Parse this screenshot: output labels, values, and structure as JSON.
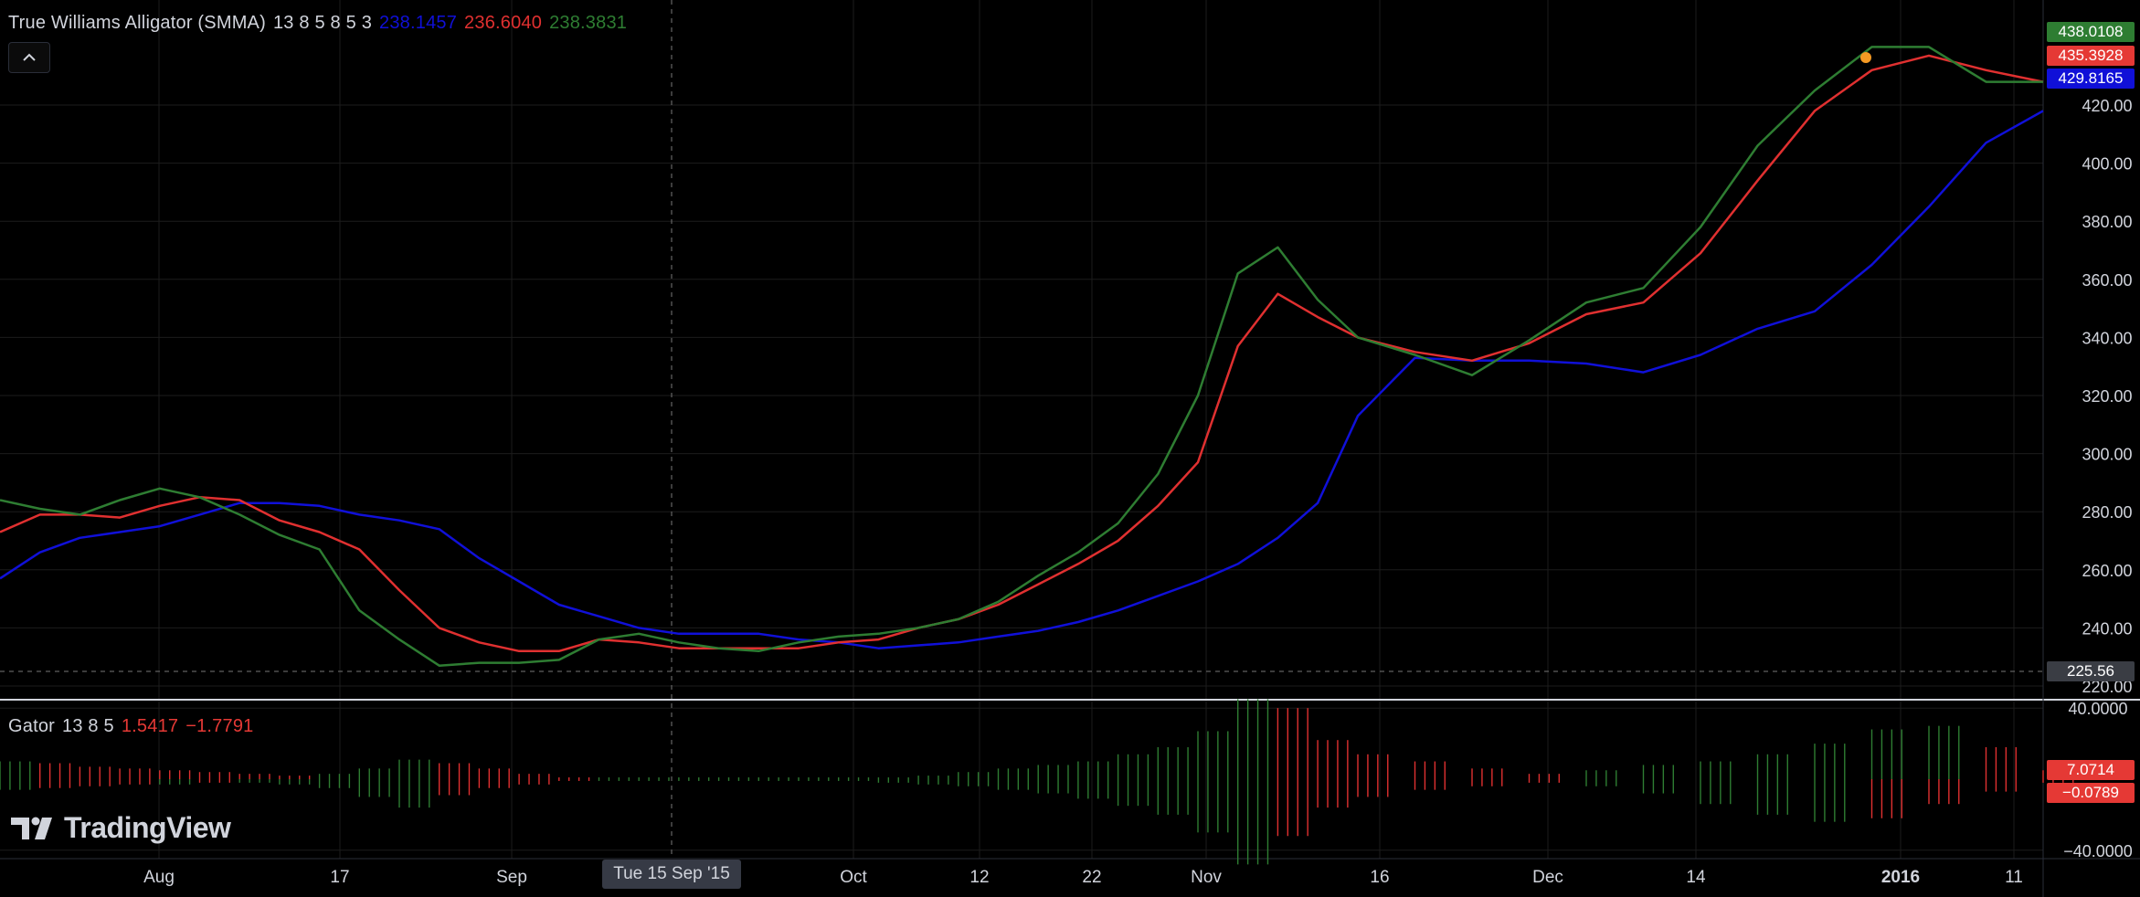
{
  "main_legend": {
    "name": "True Williams Alligator (SMMA)",
    "params": "13 8 5 8 5 3",
    "jaw_value": "238.1457",
    "teeth_value": "236.6040",
    "lips_value": "238.3831"
  },
  "gator_legend": {
    "name": "Gator",
    "params": "13 8 5",
    "upper_value": "1.5417",
    "lower_value": "−1.7791"
  },
  "price_tags": {
    "lips": "438.0108",
    "teeth": "435.3928",
    "jaw": "429.8165",
    "crosshair": "225.56",
    "gator_upper": "7.0714",
    "gator_lower": "−0.0789"
  },
  "crosshair_date": "Tue 15 Sep '15",
  "logo_text": "TradingView",
  "colors": {
    "jaw": "#1010d8",
    "teeth": "#e03030",
    "lips": "#2e7d32",
    "background": "#000000",
    "grid": "#1c1c1c",
    "text": "#d1d4dc",
    "tag_green": "#2e7d32",
    "tag_red": "#e53935",
    "tag_blue": "#1010d8",
    "tag_gray": "#3a3d44"
  },
  "icons": {
    "collapse": "chevron-up-icon",
    "logo": "tradingview-logo-icon"
  },
  "chart_data": [
    {
      "type": "line",
      "title": "True Williams Alligator (SMMA)",
      "x_ticks": [
        "Aug",
        "17",
        "Sep",
        "Oct",
        "12",
        "22",
        "Nov",
        "16",
        "Dec",
        "14",
        "2016",
        "11"
      ],
      "y_ticks": [
        220,
        240,
        260,
        280,
        300,
        320,
        340,
        360,
        380,
        400,
        420
      ],
      "ylim": [
        218,
        441
      ],
      "grid": true,
      "series": [
        {
          "name": "jaw",
          "color": "#1010d8",
          "x": [
            0,
            0.5,
            1,
            1.5,
            2,
            2.5,
            3,
            3.5,
            4,
            4.5,
            5,
            5.5,
            6,
            6.5,
            7,
            7.5,
            8,
            8.5,
            9,
            9.5,
            10,
            10.5,
            11,
            11.5,
            12,
            12.5,
            13,
            13.5,
            14,
            14.5,
            15,
            15.5,
            16,
            16.5,
            17,
            17.5,
            18,
            18.5,
            19,
            19.5,
            20,
            20.5,
            21,
            21.5,
            22,
            22.5,
            23
          ],
          "y": [
            257,
            266,
            271,
            273,
            275,
            279,
            283,
            283,
            282,
            279,
            277,
            274,
            264,
            256,
            248,
            244,
            240,
            238,
            238,
            238,
            236,
            235,
            233,
            234,
            235,
            237,
            239,
            242,
            246,
            251,
            256,
            262,
            271,
            283,
            313,
            333,
            332,
            332,
            331,
            328,
            334,
            343,
            349,
            365,
            385,
            407,
            418
          ]
        },
        {
          "name": "teeth",
          "color": "#e03030",
          "x": [
            0,
            0.5,
            1,
            1.5,
            2,
            2.5,
            3,
            3.5,
            4,
            4.5,
            5,
            5.5,
            6,
            6.5,
            7,
            7.5,
            8,
            8.5,
            9,
            9.5,
            10,
            10.5,
            11,
            11.5,
            12,
            12.5,
            13,
            13.5,
            14,
            14.5,
            15,
            15.5,
            16,
            16.5,
            17,
            17.5,
            18,
            18.5,
            19,
            19.5,
            20,
            20.5,
            21,
            21.5,
            22,
            22.5,
            23
          ],
          "y": [
            273,
            279,
            279,
            278,
            282,
            285,
            284,
            277,
            273,
            267,
            253,
            240,
            235,
            232,
            232,
            236,
            235,
            233,
            233,
            233,
            233,
            235,
            236,
            240,
            243,
            248,
            255,
            262,
            270,
            282,
            297,
            337,
            355,
            347,
            340,
            335,
            332,
            338,
            348,
            352,
            369,
            394,
            418,
            432,
            437,
            432,
            428
          ]
        },
        {
          "name": "lips",
          "color": "#2e7d32",
          "x": [
            0,
            0.5,
            1,
            1.5,
            2,
            2.5,
            3,
            3.5,
            4,
            4.5,
            5,
            5.5,
            6,
            6.5,
            7,
            7.5,
            8,
            8.5,
            9,
            9.5,
            10,
            10.5,
            11,
            11.5,
            12,
            12.5,
            13,
            13.5,
            14,
            14.5,
            15,
            15.5,
            16,
            16.5,
            17,
            17.5,
            18,
            18.5,
            19,
            19.5,
            20,
            20.5,
            21,
            21.5,
            22,
            22.5,
            23
          ],
          "y": [
            284,
            281,
            279,
            284,
            288,
            285,
            279,
            272,
            267,
            246,
            236,
            227,
            228,
            228,
            229,
            236,
            238,
            235,
            233,
            232,
            235,
            237,
            238,
            240,
            243,
            249,
            258,
            266,
            276,
            293,
            320,
            362,
            371,
            353,
            340,
            334,
            327,
            339,
            352,
            357,
            378,
            406,
            425,
            440,
            440,
            428,
            428
          ]
        }
      ]
    },
    {
      "type": "bar",
      "title": "Gator",
      "y_ticks": [
        -40,
        40
      ],
      "ylim": [
        -48,
        48
      ],
      "grid": true,
      "series": [
        {
          "name": "upper",
          "color_up": "#2e7d32",
          "color_down": "#e03030",
          "x": [
            0,
            0.5,
            1,
            1.5,
            2,
            2.5,
            3,
            3.5,
            4,
            4.5,
            5,
            5.5,
            6,
            6.5,
            7,
            7.5,
            8,
            8.5,
            9,
            9.5,
            10,
            10.5,
            11,
            11.5,
            12,
            12.5,
            13,
            13.5,
            14,
            14.5,
            15,
            15.5,
            16,
            16.5,
            17,
            17.5,
            18,
            18.5,
            19,
            19.5,
            20,
            20.5,
            21,
            21.5,
            22,
            22.5,
            23
          ],
          "y": [
            10,
            9,
            7,
            6,
            5,
            4,
            3,
            2,
            3,
            6,
            11,
            9,
            6,
            3,
            1,
            1,
            1,
            1,
            1,
            1,
            1,
            1,
            1,
            2,
            4,
            6,
            8,
            10,
            14,
            18,
            27,
            45,
            40,
            22,
            14,
            10,
            6,
            3,
            5,
            8,
            10,
            14,
            20,
            28,
            30,
            18,
            5
          ]
        },
        {
          "name": "lower",
          "color_up": "#2e7d32",
          "color_down": "#e03030",
          "x": [
            0,
            0.5,
            1,
            1.5,
            2,
            2.5,
            3,
            3.5,
            4,
            4.5,
            5,
            5.5,
            6,
            6.5,
            7,
            7.5,
            8,
            8.5,
            9,
            9.5,
            10,
            10.5,
            11,
            11.5,
            12,
            12.5,
            13,
            13.5,
            14,
            14.5,
            15,
            15.5,
            16,
            16.5,
            17,
            17.5,
            18,
            18.5,
            19,
            19.5,
            20,
            20.5,
            21,
            21.5,
            22,
            22.5,
            23
          ],
          "y": [
            -6,
            -5,
            -4,
            -3,
            -3,
            -2,
            -2,
            -3,
            -5,
            -10,
            -16,
            -9,
            -5,
            -3,
            -1,
            -1,
            -1,
            -1,
            -1,
            -1,
            -1,
            -1,
            -2,
            -3,
            -4,
            -6,
            -8,
            -11,
            -15,
            -20,
            -30,
            -48,
            -32,
            -16,
            -10,
            -6,
            -4,
            -2,
            -4,
            -8,
            -14,
            -20,
            -24,
            -22,
            -14,
            -7,
            -2
          ]
        }
      ]
    }
  ]
}
